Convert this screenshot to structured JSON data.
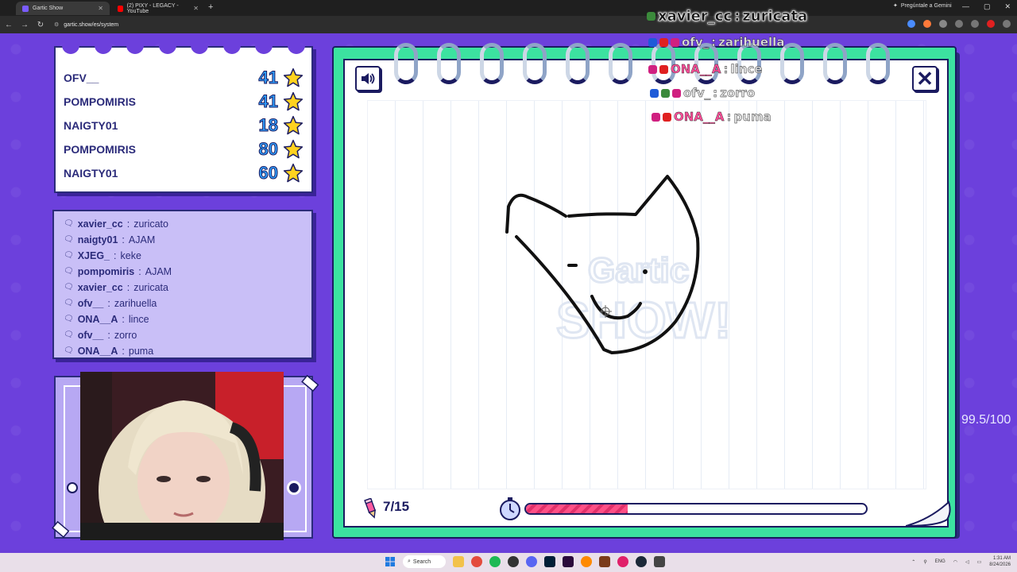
{
  "browser": {
    "tabs": [
      {
        "title": "Gartic Show",
        "active": true
      },
      {
        "title": "(2) PIXY - LEGACY - YouTube",
        "active": false
      }
    ],
    "new_tab": "+",
    "url": "gartic.show/es/system",
    "gemini_label": "Pregúntale a Gemini"
  },
  "scoreboard": [
    {
      "name": "OFV__",
      "score": "41"
    },
    {
      "name": "POMPOMIRIS",
      "score": "41"
    },
    {
      "name": "NAIGTY01",
      "score": "18"
    },
    {
      "name": "POMPOMIRIS",
      "score": "80"
    },
    {
      "name": "NAIGTY01",
      "score": "60"
    }
  ],
  "chat": [
    {
      "user": "xavier_cc",
      "msg": "zuricato"
    },
    {
      "user": "naigty01",
      "msg": "AJAM"
    },
    {
      "user": "XJEG_",
      "msg": "keke"
    },
    {
      "user": "pompomiris",
      "msg": "AJAM"
    },
    {
      "user": "xavier_cc",
      "msg": "zuricata"
    },
    {
      "user": "ofv__",
      "msg": "zarihuella"
    },
    {
      "user": "ONA__A",
      "msg": "lince"
    },
    {
      "user": "ofv__",
      "msg": "zorro"
    },
    {
      "user": "ONA__A",
      "msg": "puma"
    }
  ],
  "game": {
    "round": "7/15",
    "timer_progress": 0.3,
    "close_label": "✕"
  },
  "overlay": {
    "top": {
      "user": "xavier_cc",
      "msg": "zuricata"
    },
    "lines": [
      {
        "user": "ofv_",
        "msg": "zarihuella"
      },
      {
        "user": "ONA__A",
        "msg": "lince"
      },
      {
        "user": "ofv_",
        "msg": "zorro"
      },
      {
        "user": "ONA__A",
        "msg": "puma"
      }
    ],
    "side_score": "99.5/100"
  },
  "taskbar": {
    "search_label": "Search",
    "lang": "ENG",
    "time": "1:31 AM",
    "date": "8/24/2026"
  },
  "colors": {
    "background": "#6c40dc",
    "notebook": "#3ce2a0",
    "accent_pink": "#ff4f86",
    "score_blue": "#2fa0ff"
  }
}
